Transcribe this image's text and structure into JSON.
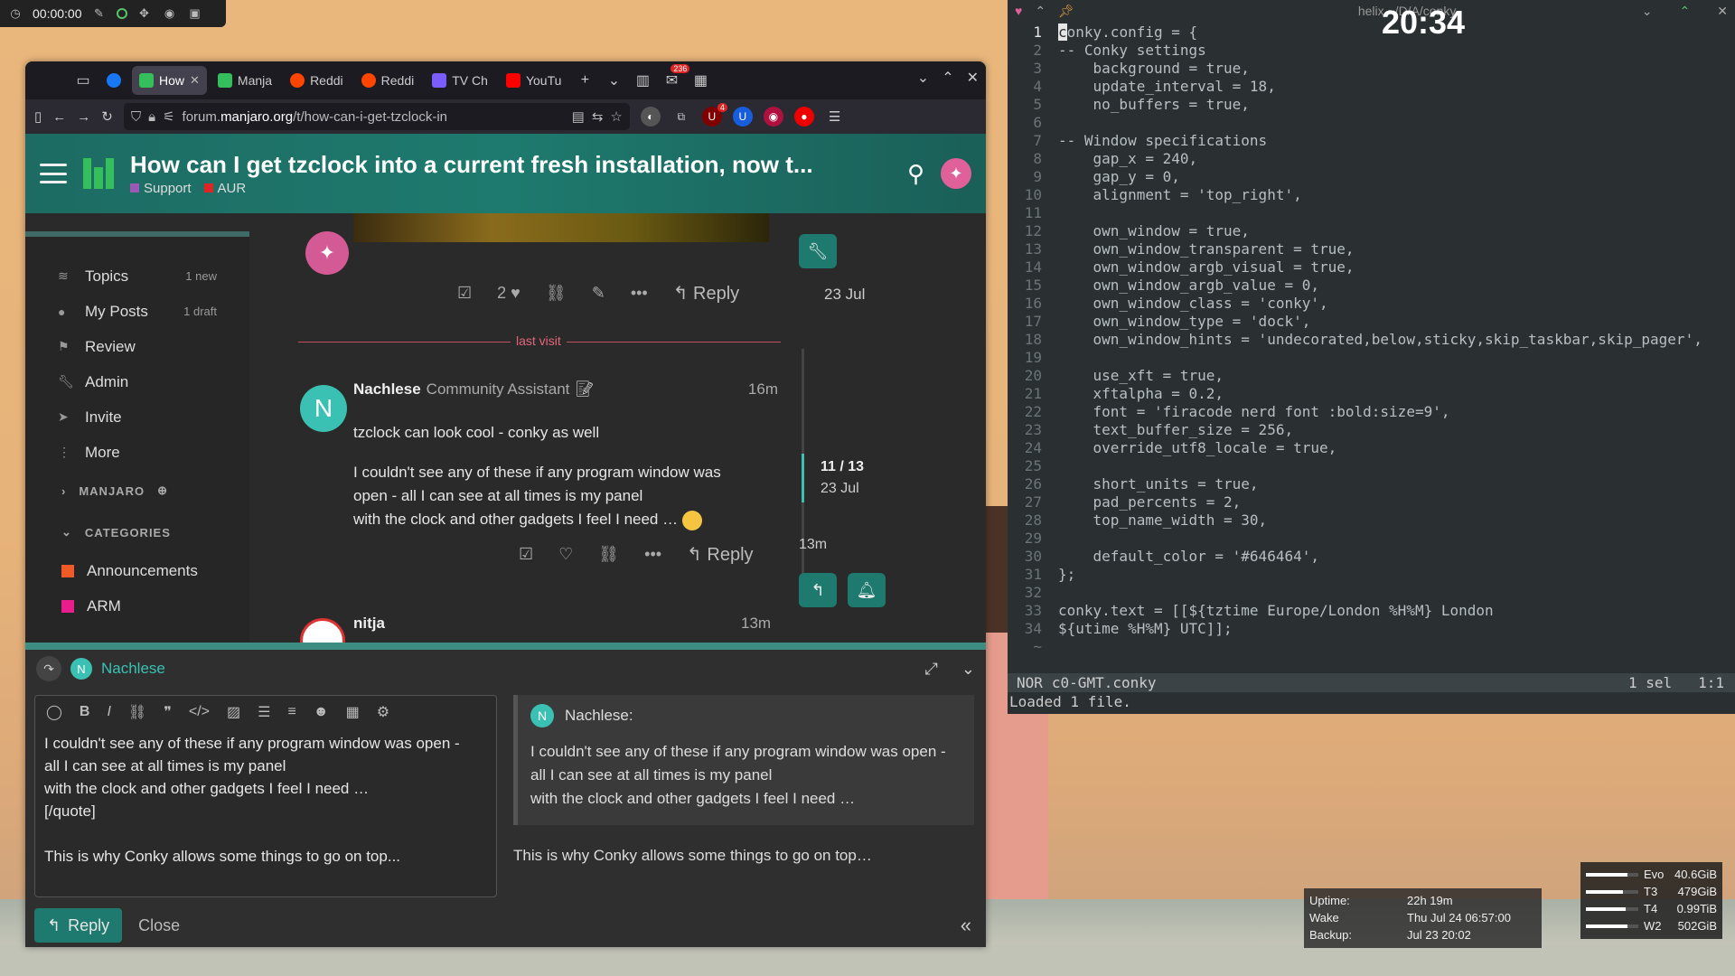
{
  "recorder": {
    "time": "00:00:00"
  },
  "browser": {
    "tabs": [
      {
        "label": "How",
        "icon": "manjaro-favicon",
        "active": true
      },
      {
        "label": "Manja",
        "icon": "manjaro-favicon"
      },
      {
        "label": "Reddi",
        "icon": "reddit-favicon"
      },
      {
        "label": "Reddi",
        "icon": "reddit-favicon"
      },
      {
        "label": "TV Ch",
        "icon": "tv-favicon"
      },
      {
        "label": "YouTu",
        "icon": "youtube-favicon"
      }
    ],
    "badge_count": "236",
    "ext_badge": "4",
    "url_prefix": "forum.",
    "url_host": "manjaro.org",
    "url_path": "/t/how-can-i-get-tzclock-in"
  },
  "forum": {
    "title": "How can I get tzclock into a current fresh installation, now t...",
    "categories": [
      {
        "name": "Support",
        "color": "#9b59b6"
      },
      {
        "name": "AUR",
        "color": "#e02424"
      }
    ],
    "sidebar": {
      "items": [
        {
          "label": "Topics",
          "count": "1 new",
          "icon": "layers-icon"
        },
        {
          "label": "My Posts",
          "count": "1 draft",
          "icon": "user-icon"
        },
        {
          "label": "Review",
          "count": "",
          "icon": "flag-icon"
        },
        {
          "label": "Admin",
          "count": "",
          "icon": "wrench-icon"
        },
        {
          "label": "Invite",
          "count": "",
          "icon": "paper-plane-icon"
        },
        {
          "label": "More",
          "count": "",
          "icon": "more-vertical-icon"
        }
      ],
      "section_manjaro": "MANJARO",
      "section_categories": "CATEGORIES",
      "categories": [
        {
          "label": "Announcements",
          "color": "#f05a28"
        },
        {
          "label": "ARM",
          "color": "#e91e8c"
        }
      ]
    },
    "prev_post": {
      "likes": "2",
      "reply_label": "Reply",
      "date": "23 Jul"
    },
    "last_visit_label": "last visit",
    "post": {
      "author": "Nachlese",
      "user_title": "Community Assistant",
      "age": "16m",
      "para1": "tzclock can look cool - conky as well",
      "para2_line1": "I couldn't see any of these if any program window was",
      "para2_line2": "open - all I can see at all times is my panel",
      "para2_line3": "with the clock and other gadgets I feel I need …",
      "reply_label": "Reply"
    },
    "timeline": {
      "position": "11 / 13",
      "date": "23 Jul",
      "recent": "13m"
    },
    "next_post": {
      "author": "nitja",
      "age": "13m"
    }
  },
  "composer": {
    "reply_to": "Nachlese",
    "editor_lines": [
      "I couldn't see any of these if any program window was open -",
      "all I can see at all times is my panel",
      "with the clock and other gadgets I feel I need …",
      "[/quote]",
      "",
      "This is why Conky allows some things to go on top..."
    ],
    "preview_author": "Nachlese:",
    "preview_quote_1": "I couldn't see any of these if any program window was open -",
    "preview_quote_2": "all I can see at all times is my panel",
    "preview_quote_3": "with the clock and other gadgets I feel I need …",
    "preview_after": "This is why Conky allows some things to go on top…",
    "reply_button": "Reply",
    "close_button": "Close"
  },
  "terminal": {
    "title": "helix ~/D/A/conky",
    "clock": "20:34",
    "lines": [
      "conky.config = {",
      "-- Conky settings",
      "    background = true,",
      "    update_interval = 18,",
      "    no_buffers = true,",
      "",
      "-- Window specifications",
      "    gap_x = 240,",
      "    gap_y = 0,",
      "    alignment = 'top_right',",
      "",
      "    own_window = true,",
      "    own_window_transparent = true,",
      "    own_window_argb_visual = true,",
      "    own_window_argb_value = 0,",
      "    own_window_class = 'conky',",
      "    own_window_type = 'dock',",
      "    own_window_hints = 'undecorated,below,sticky,skip_taskbar,skip_pager',",
      "",
      "    use_xft = true,",
      "    xftalpha = 0.2,",
      "    font = 'firacode nerd font :bold:size=9',",
      "    text_buffer_size = 256,",
      "    override_utf8_locale = true,",
      "",
      "    short_units = true,",
      "    pad_percents = 2,",
      "    top_name_width = 30,",
      "",
      "    default_color = '#646464',",
      "};",
      "",
      "conky.text = [[${tztime Europe/London %H%M} London",
      "${utime %H%M} UTC]];"
    ],
    "tilde": "~",
    "mode": "NOR",
    "file": "c0-GMT.conky",
    "sel": "1 sel",
    "pos": "1:1",
    "message": "Loaded 1 file."
  },
  "conky_status": {
    "uptime_label": "Uptime:",
    "uptime": "22h 19m",
    "wake_label": "Wake",
    "wake": "Thu Jul 24 06:57:00",
    "backup_label": "Backup:",
    "backup": "Jul 23 20:02"
  },
  "drives": [
    {
      "name": "Evo",
      "size": "40.6GiB",
      "fill": 0.8
    },
    {
      "name": "T3",
      "size": "479GiB",
      "fill": 0.7
    },
    {
      "name": "T4",
      "size": "0.99TiB",
      "fill": 0.75
    },
    {
      "name": "W2",
      "size": "502GiB",
      "fill": 0.8
    }
  ]
}
